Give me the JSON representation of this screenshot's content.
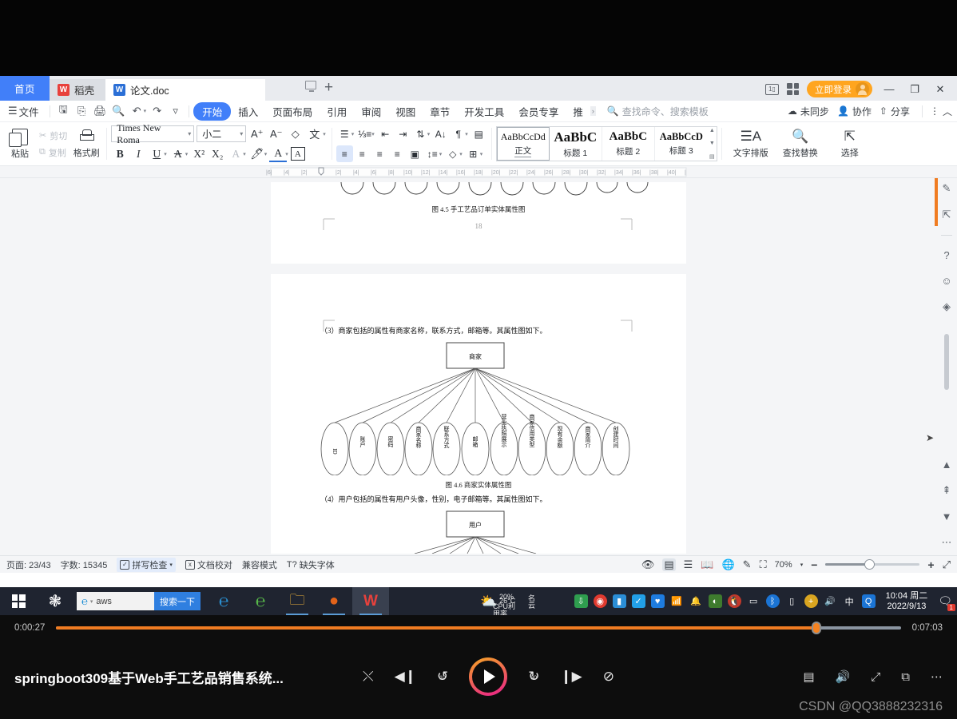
{
  "window": {
    "tabs": [
      {
        "label": "首页",
        "icon": "home-icon"
      },
      {
        "label": "稻壳",
        "icon": "docer-icon"
      },
      {
        "label": "论文.doc",
        "icon": "wps-doc-icon"
      }
    ],
    "new_tab": "+",
    "login_button": "立即登录",
    "minimize": "—",
    "restore": "❐",
    "close": "✕"
  },
  "menu": {
    "file": "文件",
    "quick_icons": [
      "save-icon",
      "save-as-icon",
      "print-icon",
      "print-preview-icon",
      "undo-icon",
      "redo-icon",
      "customize-icon"
    ],
    "tabs": [
      {
        "label": "开始",
        "active": true
      },
      {
        "label": "插入",
        "active": false
      },
      {
        "label": "页面布局",
        "active": false
      },
      {
        "label": "引用",
        "active": false
      },
      {
        "label": "审阅",
        "active": false
      },
      {
        "label": "视图",
        "active": false
      },
      {
        "label": "章节",
        "active": false
      },
      {
        "label": "开发工具",
        "active": false
      },
      {
        "label": "会员专享",
        "active": false
      },
      {
        "label": "推",
        "active": false
      }
    ],
    "search_placeholder": "查找命令、搜索模板",
    "sync_status": "未同步",
    "collaborate": "协作",
    "share": "分享",
    "more": "⋮",
    "collapse": "︿"
  },
  "ribbon": {
    "paste": "粘贴",
    "cut": "剪切",
    "copy": "复制",
    "format_painter": "格式刷",
    "font_name": "Times New Roma",
    "font_size": "小二",
    "grow_font": "A",
    "shrink_font": "A",
    "clear_format": "clear-format-icon",
    "pinyin": "拼音指南",
    "bold": "B",
    "italic": "I",
    "underline": "U",
    "strikethrough": "A",
    "superscript": "X²",
    "subscript": "X₂",
    "char_border": "A",
    "highlight": "highlight-icon",
    "font_color": "A",
    "text_box": "A",
    "styles": [
      {
        "preview": "AaBbCcDd",
        "name": "正文",
        "selected": true
      },
      {
        "preview": "AaBbC",
        "name": "标题 1",
        "selected": false
      },
      {
        "preview": "AaBbC",
        "name": "标题 2",
        "selected": false
      },
      {
        "preview": "AaBbCcD",
        "name": "标题 3",
        "selected": false
      }
    ],
    "text_layout": "文字排版",
    "find_replace": "查找替换",
    "select": "选择"
  },
  "document": {
    "page1": {
      "figure_caption": "图 4.5  手工艺品订单实体属性图",
      "page_number": "18"
    },
    "page2": {
      "para3": "（3）商家包括的属性有商家名称，联系方式，邮箱等。其属性图如下。",
      "entity_merchant": "商家",
      "merchant_attributes": [
        "ID",
        "账户",
        "密码",
        "商家名称",
        "联系方式",
        "邮箱",
        "营业执照展示",
        "商家信用类型",
        "现有余额",
        "商家简介",
        "创建时间"
      ],
      "figure_caption": "图 4.6  商家实体属性图",
      "para4": "（4）用户包括的属性有用户头像，性别，电子邮箱等。其属性图如下。",
      "entity_user": "用户"
    }
  },
  "statusbar": {
    "page_label": "页面: 23/43",
    "word_count": "字数: 15345",
    "spell_check": "拼写检查",
    "doc_proof": "文档校对",
    "compat_mode": "兼容模式",
    "missing_font": "缺失字体",
    "view_icons": [
      "eye-icon",
      "page-view-icon",
      "outline-view-icon",
      "reading-view-icon",
      "web-view-icon",
      "edit-view-icon"
    ],
    "fit_icon": "fit-page-icon",
    "zoom": "70%",
    "zoom_out": "−",
    "zoom_in": "+",
    "fullscreen": "fullscreen-icon"
  },
  "taskbar": {
    "start": "start-icon",
    "search_value": "aws",
    "search_button": "搜索一下",
    "apps": [
      "ie-icon",
      "360-browser-icon",
      "file-explorer-icon",
      "maxthon-icon",
      "wps-icon"
    ],
    "weather_temp": "26°C",
    "cpu_label": "CPU利用率",
    "cpu_value": "20%",
    "cloud_label": "名云",
    "tray_icons": [
      "download-icon",
      "360-safe-icon",
      "usb-icon",
      "tim-icon",
      "tencent-icon",
      "wifi-icon",
      "bell-icon",
      "nvidia-icon",
      "qq-icon",
      "penguin-icon",
      "battery-icon",
      "bluetooth-icon",
      "usb2-icon",
      "update-icon",
      "volume-icon",
      "ime-icon",
      "qq-browser-icon"
    ],
    "ime": "中",
    "time": "10:04 周二",
    "date": "2022/9/13",
    "notification_count": "1"
  },
  "player": {
    "current_time": "0:00:27",
    "total_time": "0:07:03",
    "progress_percent": 90,
    "title": "springboot309基于Web手工艺品销售系统...",
    "shuffle": "shuffle-icon",
    "previous": "previous-icon",
    "rewind": "rewind-10-icon",
    "rewind_num": "10",
    "play": "play-icon",
    "forward": "forward-30-icon",
    "forward_num": "30",
    "next": "next-icon",
    "no_repeat": "no-repeat-icon",
    "subtitles": "subtitles-icon",
    "volume": "volume-icon",
    "expand": "expand-icon",
    "pip": "picture-in-picture-icon",
    "more": "more-icon",
    "watermark": "CSDN @QQ3888232316"
  },
  "colors": {
    "accent_blue": "#417ff9",
    "login_orange": "#ffa51f",
    "progress_orange": "#f07c22",
    "taskbar_bg": "#1f2430"
  }
}
